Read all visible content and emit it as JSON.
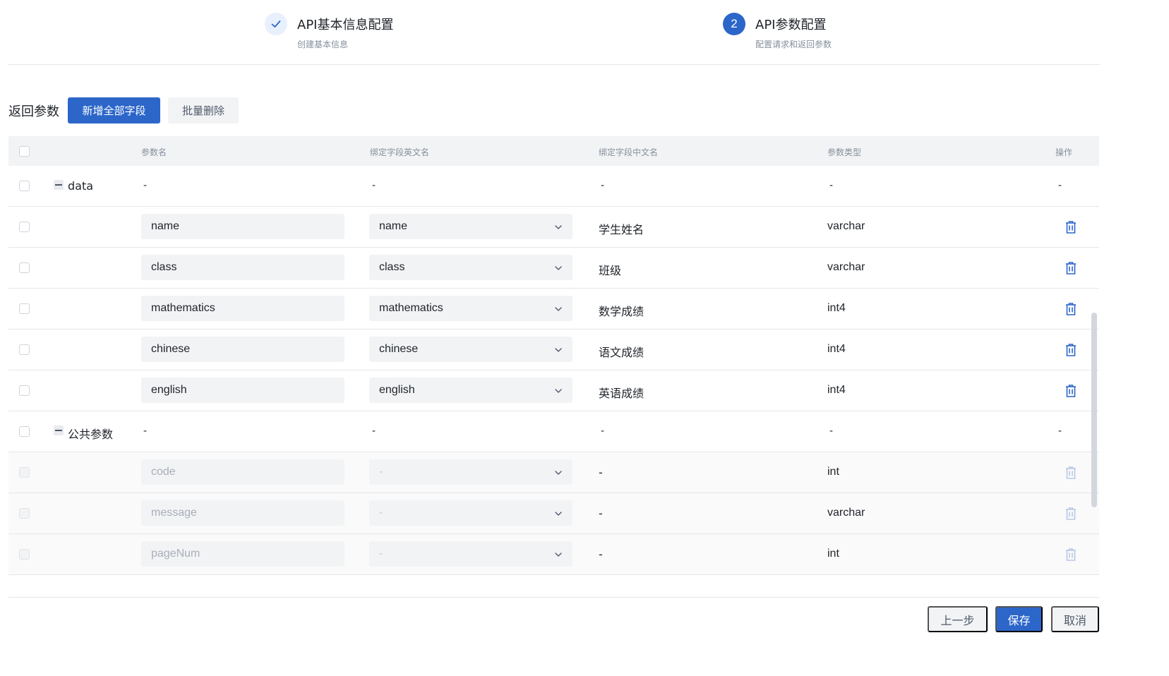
{
  "steps": [
    {
      "title": "API基本信息配置",
      "subtitle": "创建基本信息",
      "state": "done"
    },
    {
      "number": "2",
      "title": "API参数配置",
      "subtitle": "配置请求和返回参数",
      "state": "active"
    }
  ],
  "toolbar": {
    "section_title": "返回参数",
    "add_all_label": "新增全部字段",
    "batch_delete_label": "批量删除"
  },
  "table": {
    "headers": {
      "param_name": "参数名",
      "bind_en": "绑定字段英文名",
      "bind_cn": "绑定字段中文名",
      "param_type": "参数类型",
      "actions": "操作"
    },
    "rows": [
      {
        "kind": "group",
        "label": "data",
        "dash": "-"
      },
      {
        "kind": "field",
        "name": "name",
        "bind_en": "name",
        "bind_cn": "学生姓名",
        "type": "varchar"
      },
      {
        "kind": "field",
        "name": "class",
        "bind_en": "class",
        "bind_cn": "班级",
        "type": "varchar"
      },
      {
        "kind": "field",
        "name": "mathematics",
        "bind_en": "mathematics",
        "bind_cn": "数学成绩",
        "type": "int4"
      },
      {
        "kind": "field",
        "name": "chinese",
        "bind_en": "chinese",
        "bind_cn": "语文成绩",
        "type": "int4"
      },
      {
        "kind": "field",
        "name": "english",
        "bind_en": "english",
        "bind_cn": "英语成绩",
        "type": "int4"
      },
      {
        "kind": "group",
        "label": "公共参数",
        "dash": "-"
      },
      {
        "kind": "disabled",
        "name": "code",
        "bind_en": "-",
        "bind_cn": "-",
        "type": "int"
      },
      {
        "kind": "disabled",
        "name": "message",
        "bind_en": "-",
        "bind_cn": "-",
        "type": "varchar"
      },
      {
        "kind": "disabled",
        "name": "pageNum",
        "bind_en": "-",
        "bind_cn": "-",
        "type": "int"
      }
    ]
  },
  "footer": {
    "prev_label": "上一步",
    "save_label": "保存",
    "cancel_label": "取消"
  },
  "colors": {
    "primary": "#2c66c9",
    "icon_active": "#2c66c9",
    "icon_disabled": "#b8c8e6"
  },
  "icons": {
    "step_done": "check-icon",
    "collapse": "minus-square-icon",
    "dropdown": "chevron-down-icon",
    "delete": "trash-icon"
  }
}
